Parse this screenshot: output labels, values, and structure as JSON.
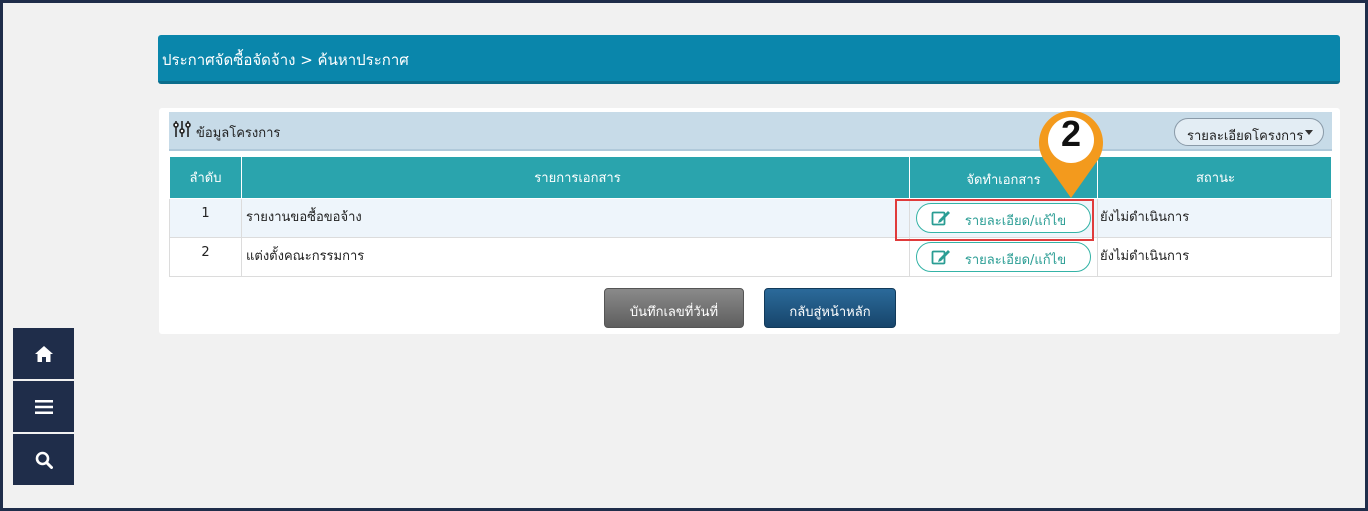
{
  "breadcrumb": "ประกาศจัดซื้อจัดจ้าง > ค้นหาประกาศ",
  "panel": {
    "title": "ข้อมูลโครงการ",
    "dropdown_label": "รายละเอียดโครงการ"
  },
  "table": {
    "headers": [
      "ลำดับ",
      "รายการเอกสาร",
      "จัดทำเอกสาร",
      "สถานะ"
    ],
    "rows": [
      {
        "no": "1",
        "doc": "รายงานขอซื้อขอจ้าง",
        "action": "รายละเอียด/แก้ไข",
        "status": "ยังไม่ดำเนินการ"
      },
      {
        "no": "2",
        "doc": "แต่งตั้งคณะกรรมการ",
        "action": "รายละเอียด/แก้ไข",
        "status": "ยังไม่ดำเนินการ"
      }
    ]
  },
  "buttons": {
    "save_date": "บันทึกเลขที่วันที่",
    "back_home": "กลับสู่หน้าหลัก"
  },
  "annotation": {
    "step_number": "2",
    "marker_color": "#f39a1d",
    "highlight_color": "#e03b3b"
  },
  "side_nav": [
    "home-icon",
    "menu-icon",
    "search-icon"
  ],
  "colors": {
    "header": "#0a86ab",
    "table_header": "#2aa4ad",
    "nav": "#1f2d4a"
  }
}
